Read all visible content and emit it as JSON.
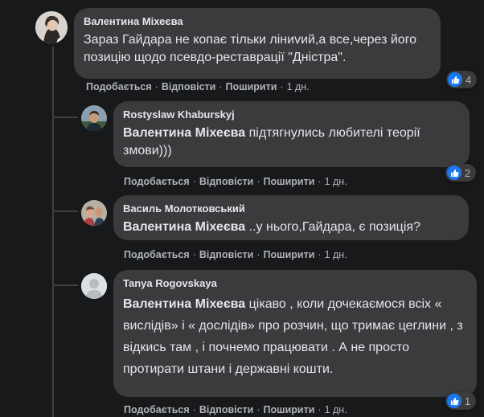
{
  "colors": {
    "bubble": "#3a3b3c",
    "background": "#18191a",
    "like": "#1877f2",
    "meta": "#b0b3b8"
  },
  "actions": {
    "like": "Подобається",
    "reply": "Відповісти",
    "share": "Поширити",
    "separator": "·"
  },
  "comments": [
    {
      "author": "Валентина Міхеєва",
      "mention": "",
      "text": "Зараз Гайдара не копає тільки ліниvий,а все,через його позицію щодо псевдо-реставрації \"Дністра\".",
      "time": "1 дн.",
      "reactions": "4",
      "avatar_icon": "user-photo-icon"
    },
    {
      "author": "Rostyslaw Khaburskyj",
      "mention": "Валентина Міхеєва",
      "text": "підтягнулись любителі теорії змови)))",
      "time": "1 дн.",
      "reactions": "2",
      "avatar_icon": "user-photo-icon"
    },
    {
      "author": "Василь Молотковський",
      "mention": "Валентина Міхеєва",
      "text": "..у нього,Гайдара, є позиція?",
      "time": "1 дн.",
      "reactions": "",
      "avatar_icon": "user-photo-icon"
    },
    {
      "author": "Tanya Rogovskaya",
      "mention": "Валентина Міхеєва",
      "text": "цікаво , коли дочекаємося всіх « вислідів» і « дослідів» про розчин, що тримає цеглини , з відкись там , і почнемо працювати . А не просто протирати штани і державні кошти.",
      "time": "1 дн.",
      "reactions": "1",
      "avatar_icon": "default-avatar-icon"
    }
  ]
}
